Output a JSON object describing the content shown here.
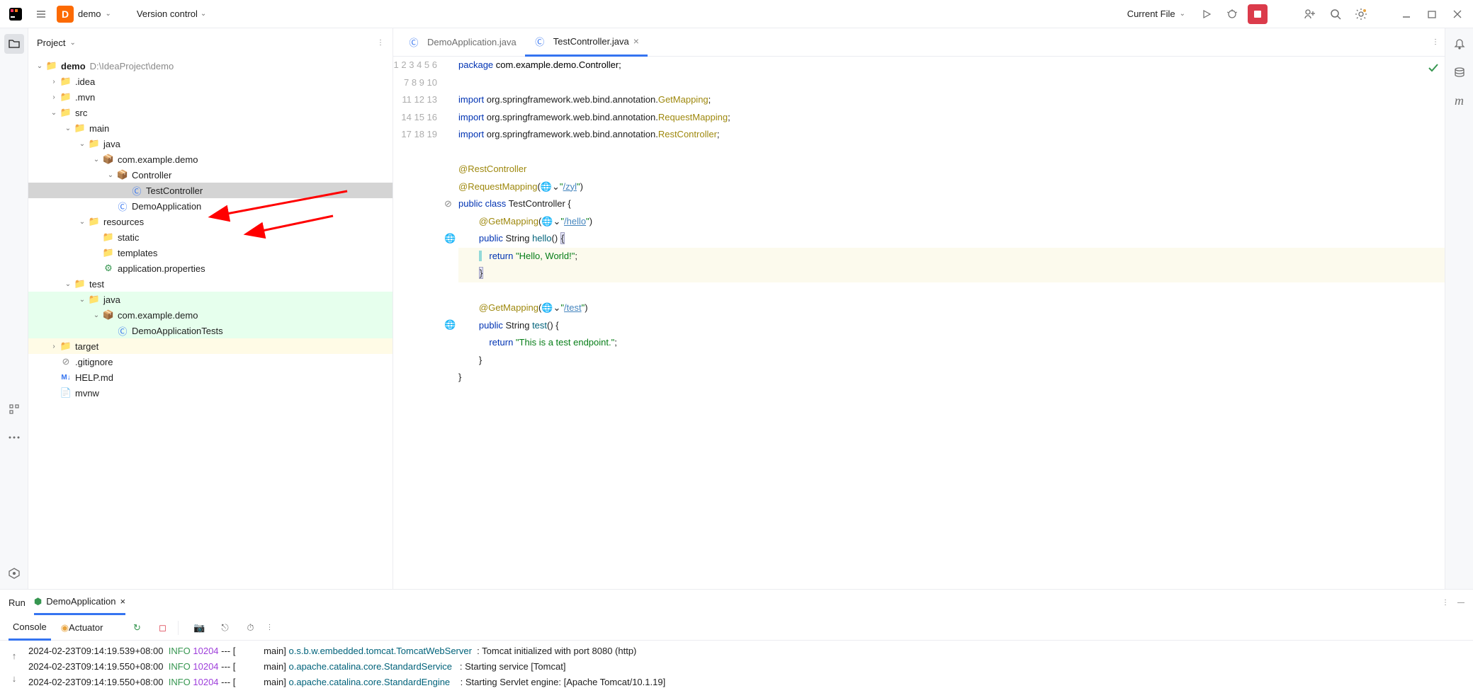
{
  "toolbar": {
    "project_name": "demo",
    "project_badge": "D",
    "vcs_label": "Version control",
    "run_config": "Current File"
  },
  "project_panel": {
    "title": "Project"
  },
  "tree": {
    "root_name": "demo",
    "root_path": "D:\\IdeaProject\\demo",
    "idea": ".idea",
    "mvn": ".mvn",
    "src": "src",
    "main": "main",
    "java": "java",
    "pkg": "com.example.demo",
    "controller_pkg": "Controller",
    "test_controller": "TestController",
    "demo_app": "DemoApplication",
    "resources": "resources",
    "static": "static",
    "templates": "templates",
    "app_props": "application.properties",
    "test": "test",
    "test_java": "java",
    "test_pkg": "com.example.demo",
    "demo_app_tests": "DemoApplicationTests",
    "target": "target",
    "gitignore": ".gitignore",
    "help_md": "HELP.md",
    "mvnw": "mvnw"
  },
  "tabs": {
    "tab1": "DemoApplication.java",
    "tab2": "TestController.java"
  },
  "code": {
    "l1_kw": "package",
    "l1_rest": " com.example.demo.Controller;",
    "l3_kw": "import",
    "l3_rest": " org.springframework.web.bind.annotation.",
    "l3_cls": "GetMapping",
    "l3_end": ";",
    "l4_kw": "import",
    "l4_rest": " org.springframework.web.bind.annotation.",
    "l4_cls": "RequestMapping",
    "l4_end": ";",
    "l5_kw": "import",
    "l5_rest": " org.springframework.web.bind.annotation.",
    "l5_cls": "RestController",
    "l5_end": ";",
    "l7_ann": "@RestController",
    "l8_ann": "@RequestMapping",
    "l8_open": "(",
    "l8_str": "\"",
    "l8_path": "/zyl",
    "l8_strend": "\"",
    "l8_close": ")",
    "l9_pub": "public",
    "l9_cls": "class",
    "l9_name": " TestController {",
    "l10_ann": "@GetMapping",
    "l10_open": "(",
    "l10_str": "\"",
    "l10_path": "/hello",
    "l10_strend": "\"",
    "l10_close": ")",
    "l11_pub": "public",
    "l11_str": " String ",
    "l11_fn": "hello",
    "l11_end": "() ",
    "l11_brace": "{",
    "l12_ret": "return",
    "l12_str": " \"Hello, World!\"",
    "l12_end": ";",
    "l13_brace": "}",
    "l15_ann": "@GetMapping",
    "l15_open": "(",
    "l15_str": "\"",
    "l15_path": "/test",
    "l15_strend": "\"",
    "l15_close": ")",
    "l16_pub": "public",
    "l16_str": " String ",
    "l16_fn": "test",
    "l16_end": "() {",
    "l17_ret": "return",
    "l17_str": " \"This is a test endpoint.\"",
    "l17_end": ";",
    "l18": "        }",
    "l19": "}"
  },
  "run": {
    "title": "Run",
    "config_name": "DemoApplication",
    "console_tab": "Console",
    "actuator_tab": "Actuator"
  },
  "console": {
    "l1_ts": "2024-02-23T09:14:19.539+08:00  ",
    "l1_info": "INFO",
    "l1_pid": " 10204",
    "l1_dash": " --- [           main] ",
    "l1_cls": "o.s.b.w.embedded.tomcat.TomcatWebServer ",
    "l1_msg": " : Tomcat initialized with port 8080 (http)",
    "l2_ts": "2024-02-23T09:14:19.550+08:00  ",
    "l2_info": "INFO",
    "l2_pid": " 10204",
    "l2_dash": " --- [           main] ",
    "l2_cls": "o.apache.catalina.core.StandardService  ",
    "l2_msg": " : Starting service [Tomcat]",
    "l3_ts": "2024-02-23T09:14:19.550+08:00  ",
    "l3_info": "INFO",
    "l3_pid": " 10204",
    "l3_dash": " --- [           main] ",
    "l3_cls": "o.apache.catalina.core.StandardEngine   ",
    "l3_msg": " : Starting Servlet engine: [Apache Tomcat/10.1.19]"
  }
}
